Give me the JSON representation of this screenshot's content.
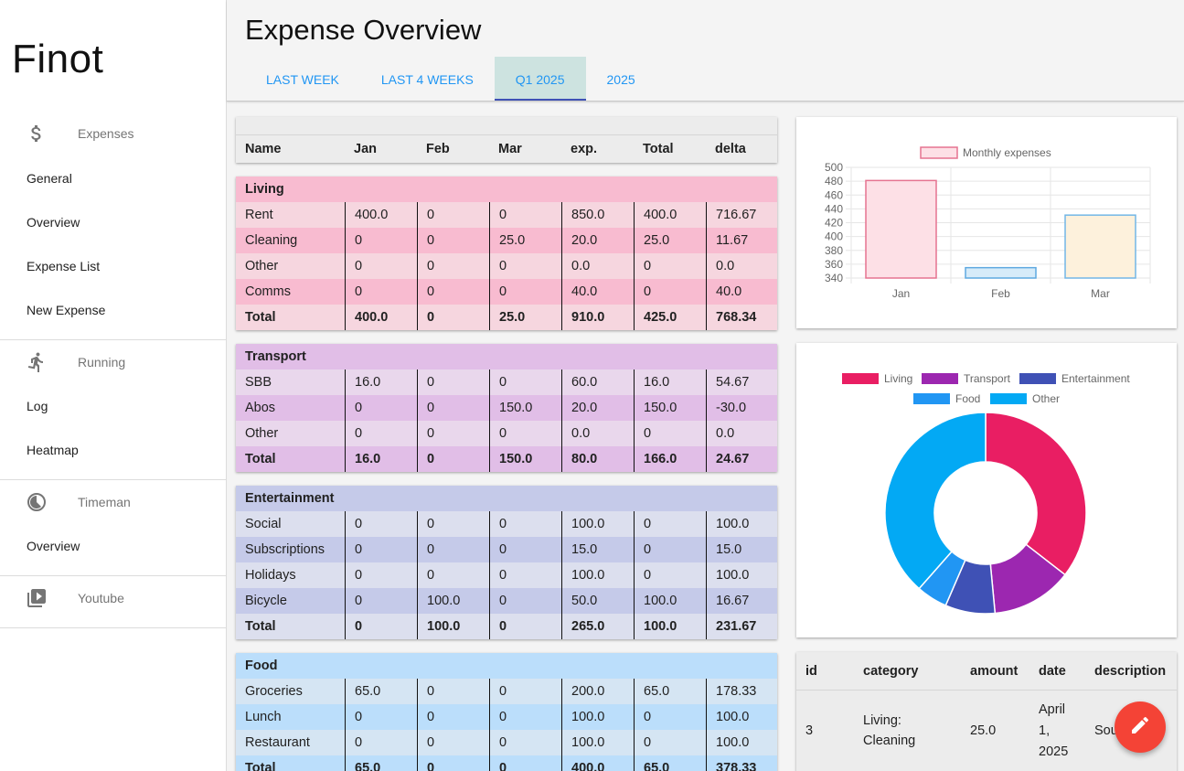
{
  "app": {
    "brand": "Finot"
  },
  "sidebar": {
    "groups": [
      {
        "label": "Expenses",
        "icon": "dollar-icon",
        "items": [
          "General",
          "Overview",
          "Expense List",
          "New Expense"
        ]
      },
      {
        "label": "Running",
        "icon": "running-icon",
        "items": [
          "Log",
          "Heatmap"
        ]
      },
      {
        "label": "Timeman",
        "icon": "timeman-icon",
        "items": [
          "Overview"
        ]
      },
      {
        "label": "Youtube",
        "icon": "video-library-icon",
        "items": []
      }
    ]
  },
  "header": {
    "title": "Expense Overview",
    "tabs": [
      "LAST WEEK",
      "LAST 4 WEEKS",
      "Q1 2025",
      "2025"
    ],
    "active_tab": "Q1 2025"
  },
  "table": {
    "columns": [
      "Name",
      "Jan",
      "Feb",
      "Mar",
      "exp.",
      "Total",
      "delta"
    ],
    "sections": [
      {
        "name": "Living",
        "title_bg": "#f8bbd0",
        "row_bgs": [
          "#f6d6df",
          "#f8bbd0"
        ],
        "rows": [
          [
            "Rent",
            "400.0",
            "0",
            "0",
            "850.0",
            "400.0",
            "716.67"
          ],
          [
            "Cleaning",
            "0",
            "0",
            "25.0",
            "20.0",
            "25.0",
            "11.67"
          ],
          [
            "Other",
            "0",
            "0",
            "0",
            "0.0",
            "0",
            "0.0"
          ],
          [
            "Comms",
            "0",
            "0",
            "0",
            "40.0",
            "0",
            "40.0"
          ]
        ],
        "total": [
          "Total",
          "400.0",
          "0",
          "25.0",
          "910.0",
          "425.0",
          "768.34"
        ]
      },
      {
        "name": "Transport",
        "title_bg": "#e1bee7",
        "row_bgs": [
          "#e9d7ec",
          "#e1bee7"
        ],
        "rows": [
          [
            "SBB",
            "16.0",
            "0",
            "0",
            "60.0",
            "16.0",
            "54.67"
          ],
          [
            "Abos",
            "0",
            "0",
            "150.0",
            "20.0",
            "150.0",
            "-30.0"
          ],
          [
            "Other",
            "0",
            "0",
            "0",
            "0.0",
            "0",
            "0.0"
          ]
        ],
        "total": [
          "Total",
          "16.0",
          "0",
          "150.0",
          "80.0",
          "166.0",
          "24.67"
        ]
      },
      {
        "name": "Entertainment",
        "title_bg": "#c5cae9",
        "row_bgs": [
          "#dcdfee",
          "#c5cae9"
        ],
        "rows": [
          [
            "Social",
            "0",
            "0",
            "0",
            "100.0",
            "0",
            "100.0"
          ],
          [
            "Subscriptions",
            "0",
            "0",
            "0",
            "15.0",
            "0",
            "15.0"
          ],
          [
            "Holidays",
            "0",
            "0",
            "0",
            "100.0",
            "0",
            "100.0"
          ],
          [
            "Bicycle",
            "0",
            "100.0",
            "0",
            "50.0",
            "100.0",
            "16.67"
          ]
        ],
        "total": [
          "Total",
          "0",
          "100.0",
          "0",
          "265.0",
          "100.0",
          "231.67"
        ]
      },
      {
        "name": "Food",
        "title_bg": "#bbdefb",
        "row_bgs": [
          "#d5e5f3",
          "#bbdefb"
        ],
        "rows": [
          [
            "Groceries",
            "65.0",
            "0",
            "0",
            "200.0",
            "65.0",
            "178.33"
          ],
          [
            "Lunch",
            "0",
            "0",
            "0",
            "100.0",
            "0",
            "100.0"
          ],
          [
            "Restaurant",
            "0",
            "0",
            "0",
            "100.0",
            "0",
            "100.0"
          ]
        ],
        "total": [
          "Total",
          "65.0",
          "0",
          "0",
          "400.0",
          "65.0",
          "378.33"
        ]
      }
    ]
  },
  "chart_data": [
    {
      "type": "bar",
      "categories": [
        "Jan",
        "Feb",
        "Mar"
      ],
      "series": [
        {
          "name": "Monthly expenses",
          "values": [
            481,
            355,
            431
          ]
        }
      ],
      "bar_fills": [
        "#fde0e6",
        "#d6ebf9",
        "#fdf1dc"
      ],
      "bar_strokes": [
        "#e57390",
        "#5fa9e0",
        "#72b6e6"
      ],
      "legend_fill": "#fde0e6",
      "legend_stroke": "#e57390",
      "yticks": [
        340,
        360,
        380,
        400,
        420,
        440,
        460,
        480,
        500
      ],
      "ylim": [
        340,
        500
      ],
      "grid": true,
      "legend": "top"
    },
    {
      "type": "pie",
      "categories": [
        "Living",
        "Transport",
        "Entertainment",
        "Food",
        "Other"
      ],
      "values": [
        910.0,
        80.0,
        265.0,
        400.0,
        1200.0
      ],
      "display_values": [
        35.5,
        13.0,
        8.0,
        5.0,
        38.5
      ],
      "colors": [
        "#e91e63",
        "#9c27b0",
        "#3f51b5",
        "#2196f3",
        "#03a9f4"
      ],
      "legend": "top"
    }
  ],
  "expense_list": {
    "columns": [
      "id",
      "category",
      "amount",
      "date",
      "description"
    ],
    "rows": [
      {
        "id": "3",
        "category_line1": "Living:",
        "category_line2": "Cleaning",
        "amount": "25.0",
        "date_line1": "April",
        "date_line2": "1,",
        "date_line3": "2025",
        "description": "Sou"
      }
    ]
  },
  "fab": {
    "icon": "edit-pencil-icon",
    "color": "#f44336"
  }
}
